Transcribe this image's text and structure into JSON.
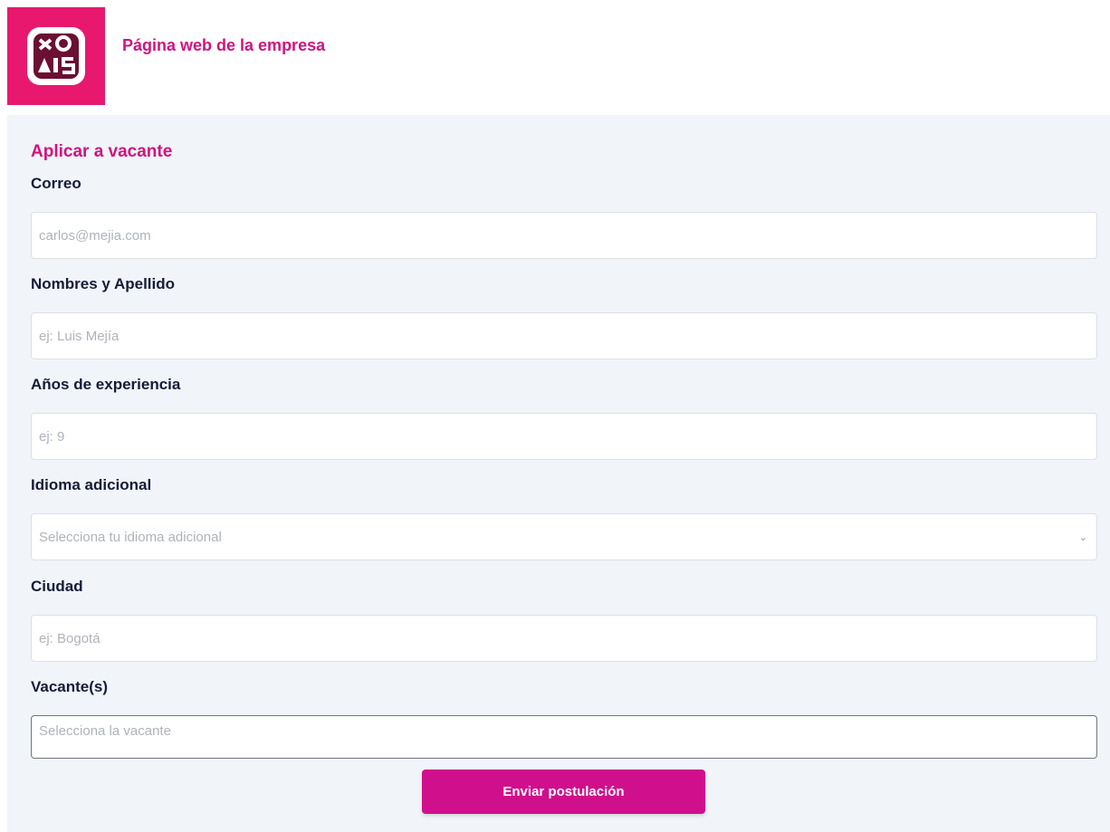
{
  "header": {
    "logo_text": "AIS",
    "title": "Página web de la empresa"
  },
  "form": {
    "title": "Aplicar a vacante",
    "fields": [
      {
        "label": "Correo",
        "placeholder": "carlos@mejia.com"
      },
      {
        "label": "Nombres y Apellido",
        "placeholder": "ej: Luis Mejía"
      },
      {
        "label": "Años de experiencia",
        "placeholder": "ej: 9"
      },
      {
        "label": "Idioma adicional",
        "placeholder": "Selecciona tu idioma adicional"
      },
      {
        "label": "Ciudad",
        "placeholder": "ej: Bogotá"
      },
      {
        "label": "Vacante(s)",
        "placeholder": "Selecciona la vacante"
      }
    ],
    "submit_label": "Enviar postulación"
  },
  "colors": {
    "brand_pink": "#d0137e",
    "logo_bg": "#e8186f",
    "panel_bg": "#f1f4f9",
    "button_bg": "#d00f8c"
  }
}
